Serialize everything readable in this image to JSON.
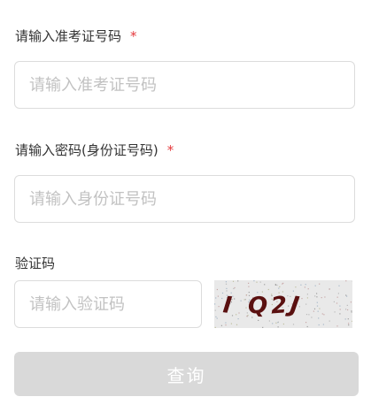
{
  "form": {
    "exam_number": {
      "label": "请输入准考证号码",
      "required_mark": "*",
      "placeholder": "请输入准考证号码",
      "value": ""
    },
    "password": {
      "label": "请输入密码(身份证号码)",
      "required_mark": "*",
      "placeholder": "请输入身份证号码",
      "value": ""
    },
    "captcha": {
      "label": "验证码",
      "placeholder": "请输入验证码",
      "value": "",
      "image_text": "I Q2J",
      "image_chars": [
        "I",
        "Q",
        "2",
        "J"
      ]
    },
    "submit_label": "查询"
  },
  "colors": {
    "required": "#e4393c",
    "border": "#dcdcdc",
    "placeholder": "#c2c2c2",
    "button_disabled": "#d9d9d9",
    "captcha_text": "#5a1010",
    "captcha_bg": "#e9e9e9"
  }
}
